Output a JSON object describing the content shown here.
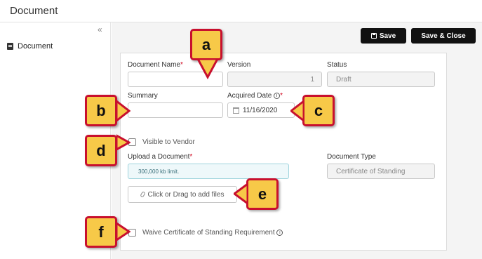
{
  "page": {
    "title": "Document"
  },
  "sidebar": {
    "collapse_glyph": "«",
    "items": [
      {
        "label": "Document",
        "icon": "document-icon"
      }
    ]
  },
  "toolbar": {
    "save_label": "Save",
    "save_close_label": "Save & Close"
  },
  "form": {
    "document_name": {
      "label": "Document Name",
      "required": "*",
      "value": ""
    },
    "version": {
      "label": "Version",
      "value": "1"
    },
    "status": {
      "label": "Status",
      "value": "Draft"
    },
    "summary": {
      "label": "Summary",
      "value": ""
    },
    "acquired_date": {
      "label": "Acquired Date",
      "info": "i",
      "required": "*",
      "value": "11/16/2020"
    },
    "visible_to_vendor": {
      "label": "Visible to Vendor",
      "checked": false
    },
    "upload": {
      "label": "Upload a Document",
      "required": "*",
      "limit_note": "300,000 kb limit.",
      "dropzone_label": "Click or Drag to add files"
    },
    "document_type": {
      "label": "Document Type",
      "value": "Certificate of Standing"
    },
    "waive": {
      "label": "Waive Certificate of Standing Requirement",
      "info": "i",
      "checked": false
    }
  },
  "callouts": {
    "a": "a",
    "b": "b",
    "c": "c",
    "d": "d",
    "e": "e",
    "f": "f"
  },
  "colors": {
    "callout_fill": "#f7c948",
    "callout_border": "#c8102e",
    "required": "#d0021b",
    "button": "#111111"
  }
}
